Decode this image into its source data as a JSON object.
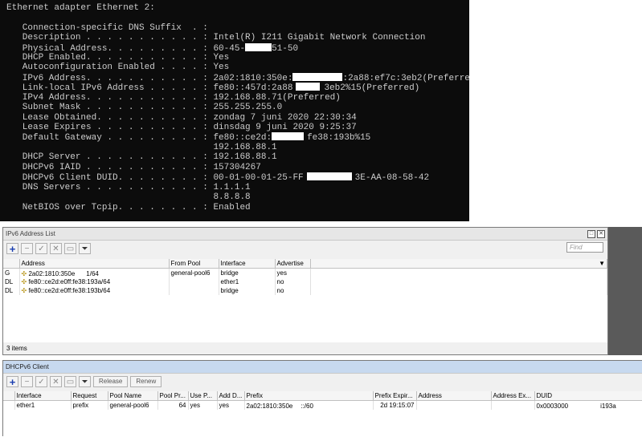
{
  "terminal": {
    "lines": [
      "Ethernet adapter Ethernet 2:",
      "",
      "   Connection-specific DNS Suffix  . :",
      "   Description . . . . . . . . . . . : Intel(R) I211 Gigabit Network Connection",
      "   Physical Address. . . . . . . . . : 60-45-",
      "   DHCP Enabled. . . . . . . . . . . : Yes",
      "   Autoconfiguration Enabled . . . . : Yes",
      "   IPv6 Address. . . . . . . . . . . : 2a02:1810:350e:",
      "   Link-local IPv6 Address . . . . . : fe80::457d:2a88",
      "   IPv4 Address. . . . . . . . . . . : 192.168.88.71(Preferred)",
      "   Subnet Mask . . . . . . . . . . . : 255.255.255.0",
      "   Lease Obtained. . . . . . . . . . : zondag 7 juni 2020 22:30:34",
      "   Lease Expires . . . . . . . . . . : dinsdag 9 juni 2020 9:25:37",
      "   Default Gateway . . . . . . . . . : fe80::ce2d:",
      "                                       192.168.88.1",
      "   DHCP Server . . . . . . . . . . . : 192.168.88.1",
      "   DHCPv6 IAID . . . . . . . . . . . : 157304267",
      "   DHCPv6 Client DUID. . . . . . . . : 00-01-00-01-25-FF",
      "   DNS Servers . . . . . . . . . . . : 1.1.1.1",
      "                                       8.8.8.8",
      "   NetBIOS over Tcpip. . . . . . . . : Enabled"
    ],
    "suffixes": {
      "4": "51-50",
      "7": ":2a88:ef7c:3eb2(Preferred)",
      "8": "3eb2%15(Preferred)",
      "13": "fe38:193b%15",
      "17": "3E-AA-08-58-42"
    }
  },
  "ipv6_window": {
    "title": "IPv6 Address List",
    "find_placeholder": "Find",
    "columns": [
      "Address",
      "From Pool",
      "Interface",
      "Advertise"
    ],
    "rows": [
      {
        "flag": "G",
        "address": "2a02:1810:350e",
        "address_end": "1/64",
        "pool": "general-pool6",
        "interface": "bridge",
        "advertise": "yes"
      },
      {
        "flag": "DL",
        "address": "fe80::ce2d:e0ff:fe38:193a/64",
        "address_end": "",
        "pool": "",
        "interface": "ether1",
        "advertise": "no"
      },
      {
        "flag": "DL",
        "address": "fe80::ce2d:e0ff:fe38:193b/64",
        "address_end": "",
        "pool": "",
        "interface": "bridge",
        "advertise": "no"
      }
    ],
    "status": "3 items"
  },
  "dhcp_window": {
    "title": "DHCPv6 Client",
    "release_label": "Release",
    "renew_label": "Renew",
    "columns": [
      "Interface",
      "Request",
      "Pool Name",
      "Pool Pr...",
      "Use P...",
      "Add D...",
      "Prefix",
      "Prefix Expir...",
      "Address",
      "Address Ex...",
      "DUID"
    ],
    "row": {
      "interface": "ether1",
      "request": "prefix",
      "pool_name": "general-pool6",
      "pool_prefix": "64",
      "use_peer": "yes",
      "add_default": "yes",
      "prefix": "2a02:1810:350e",
      "prefix_end": "::/60",
      "prefix_expires": "2d 19:15:07",
      "address": "",
      "address_expires": "",
      "duid": "0x0003000",
      "duid_end": "i193a"
    }
  }
}
